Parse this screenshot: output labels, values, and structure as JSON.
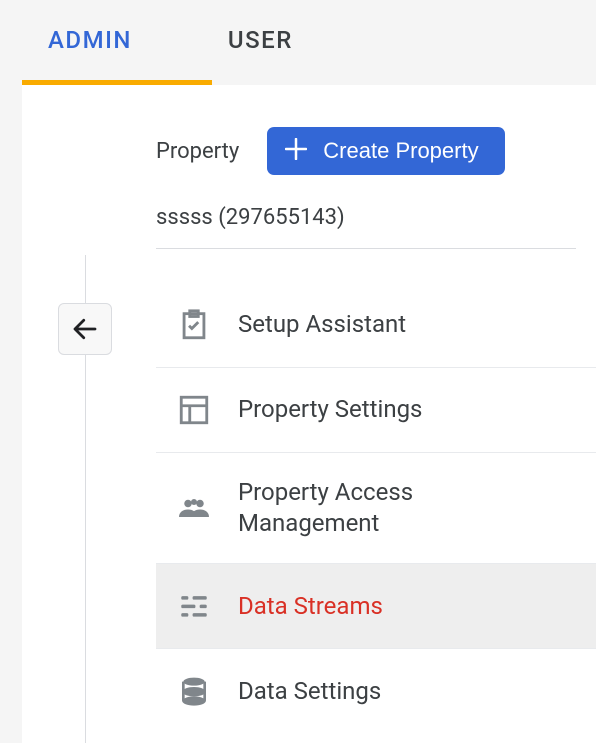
{
  "tabs": {
    "admin": "ADMIN",
    "user": "USER"
  },
  "property_label": "Property",
  "create_button": "Create Property",
  "property_name": "sssss (297655143)",
  "menu": {
    "setup_assistant": "Setup Assistant",
    "property_settings": "Property Settings",
    "property_access": "Property Access Management",
    "data_streams": "Data Streams",
    "data_settings": "Data Settings"
  }
}
